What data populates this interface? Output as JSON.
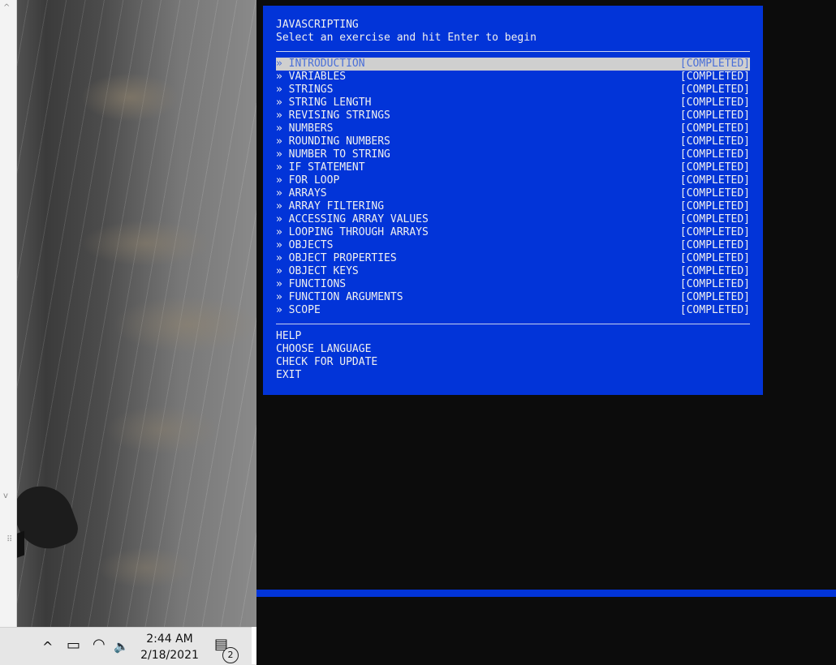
{
  "app": {
    "title": "JAVASCRIPTING",
    "subtitle": "Select an exercise and hit Enter to begin"
  },
  "exercises": [
    {
      "label": "» INTRODUCTION",
      "status": "[COMPLETED]"
    },
    {
      "label": "» VARIABLES",
      "status": "[COMPLETED]"
    },
    {
      "label": "» STRINGS",
      "status": "[COMPLETED]"
    },
    {
      "label": "» STRING LENGTH",
      "status": "[COMPLETED]"
    },
    {
      "label": "» REVISING STRINGS",
      "status": "[COMPLETED]"
    },
    {
      "label": "» NUMBERS",
      "status": "[COMPLETED]"
    },
    {
      "label": "» ROUNDING NUMBERS",
      "status": "[COMPLETED]"
    },
    {
      "label": "» NUMBER TO STRING",
      "status": "[COMPLETED]"
    },
    {
      "label": "» IF STATEMENT",
      "status": "[COMPLETED]"
    },
    {
      "label": "» FOR LOOP",
      "status": "[COMPLETED]"
    },
    {
      "label": "» ARRAYS",
      "status": "[COMPLETED]"
    },
    {
      "label": "» ARRAY FILTERING",
      "status": "[COMPLETED]"
    },
    {
      "label": "» ACCESSING ARRAY VALUES",
      "status": "[COMPLETED]"
    },
    {
      "label": "» LOOPING THROUGH ARRAYS",
      "status": "[COMPLETED]"
    },
    {
      "label": "» OBJECTS",
      "status": "[COMPLETED]"
    },
    {
      "label": "» OBJECT PROPERTIES",
      "status": "[COMPLETED]"
    },
    {
      "label": "» OBJECT KEYS",
      "status": "[COMPLETED]"
    },
    {
      "label": "» FUNCTIONS",
      "status": "[COMPLETED]"
    },
    {
      "label": "» FUNCTION ARGUMENTS",
      "status": "[COMPLETED]"
    },
    {
      "label": "» SCOPE",
      "status": "[COMPLETED]"
    }
  ],
  "footer_menu": {
    "help": "HELP",
    "choose_language": "CHOOSE LANGUAGE",
    "check_update": "CHECK FOR UPDATE",
    "exit": "EXIT"
  },
  "taskbar": {
    "time": "2:44 AM",
    "date": "2/18/2021",
    "notification_count": "2",
    "icons": {
      "chevron": "^",
      "battery": "▭",
      "wifi": "◠",
      "volume": "🔈",
      "notification": "▤"
    }
  },
  "edge_window": {
    "scroll_up": "^",
    "scroll_down": "v",
    "grip": "⠿"
  },
  "colors": {
    "panel_bg": "#0234d8",
    "selected_bg": "#cfcfcf",
    "selected_fg": "#4a6fd8",
    "terminal_bg": "#0c0c0c"
  }
}
